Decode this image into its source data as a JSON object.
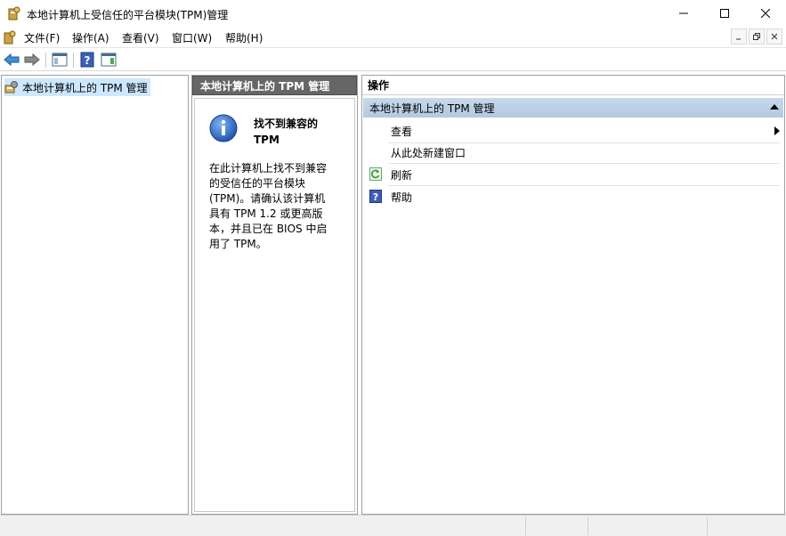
{
  "window": {
    "title": "本地计算机上受信任的平台模块(TPM)管理",
    "app_icon": "tpm-key-icon"
  },
  "menu": {
    "items": [
      "文件(F)",
      "操作(A)",
      "查看(V)",
      "窗口(W)",
      "帮助(H)"
    ]
  },
  "toolbar": {
    "icons": [
      "back-arrow-icon",
      "forward-arrow-icon",
      "show-hide-tree-icon",
      "help-icon",
      "show-hide-action-pane-icon"
    ]
  },
  "tree": {
    "selected_item": "本地计算机上的 TPM 管理"
  },
  "center": {
    "header": "本地计算机上的 TPM 管理",
    "title": "找不到兼容的 TPM",
    "message_lines": [
      "在此计算机上找不到兼容",
      "的受信任的平台模块",
      "(TPM)。请确认该计算机",
      "具有 TPM 1.2 或更高版",
      "本，并且已在 BIOS 中启",
      "用了 TPM。"
    ]
  },
  "actions": {
    "header": "操作",
    "group_title": "本地计算机上的 TPM 管理",
    "items": [
      {
        "label": "查看",
        "icon": "",
        "has_submenu": true
      },
      {
        "label": "从此处新建窗口",
        "icon": "",
        "has_submenu": false
      },
      {
        "label": "刷新",
        "icon": "refresh-icon",
        "has_submenu": false
      },
      {
        "label": "帮助",
        "icon": "help-icon",
        "has_submenu": false
      }
    ]
  },
  "colors": {
    "center_header_bg": "#666666",
    "action_group_bg": "#bcd0e6",
    "tree_selected_bg": "#cce8ff"
  }
}
